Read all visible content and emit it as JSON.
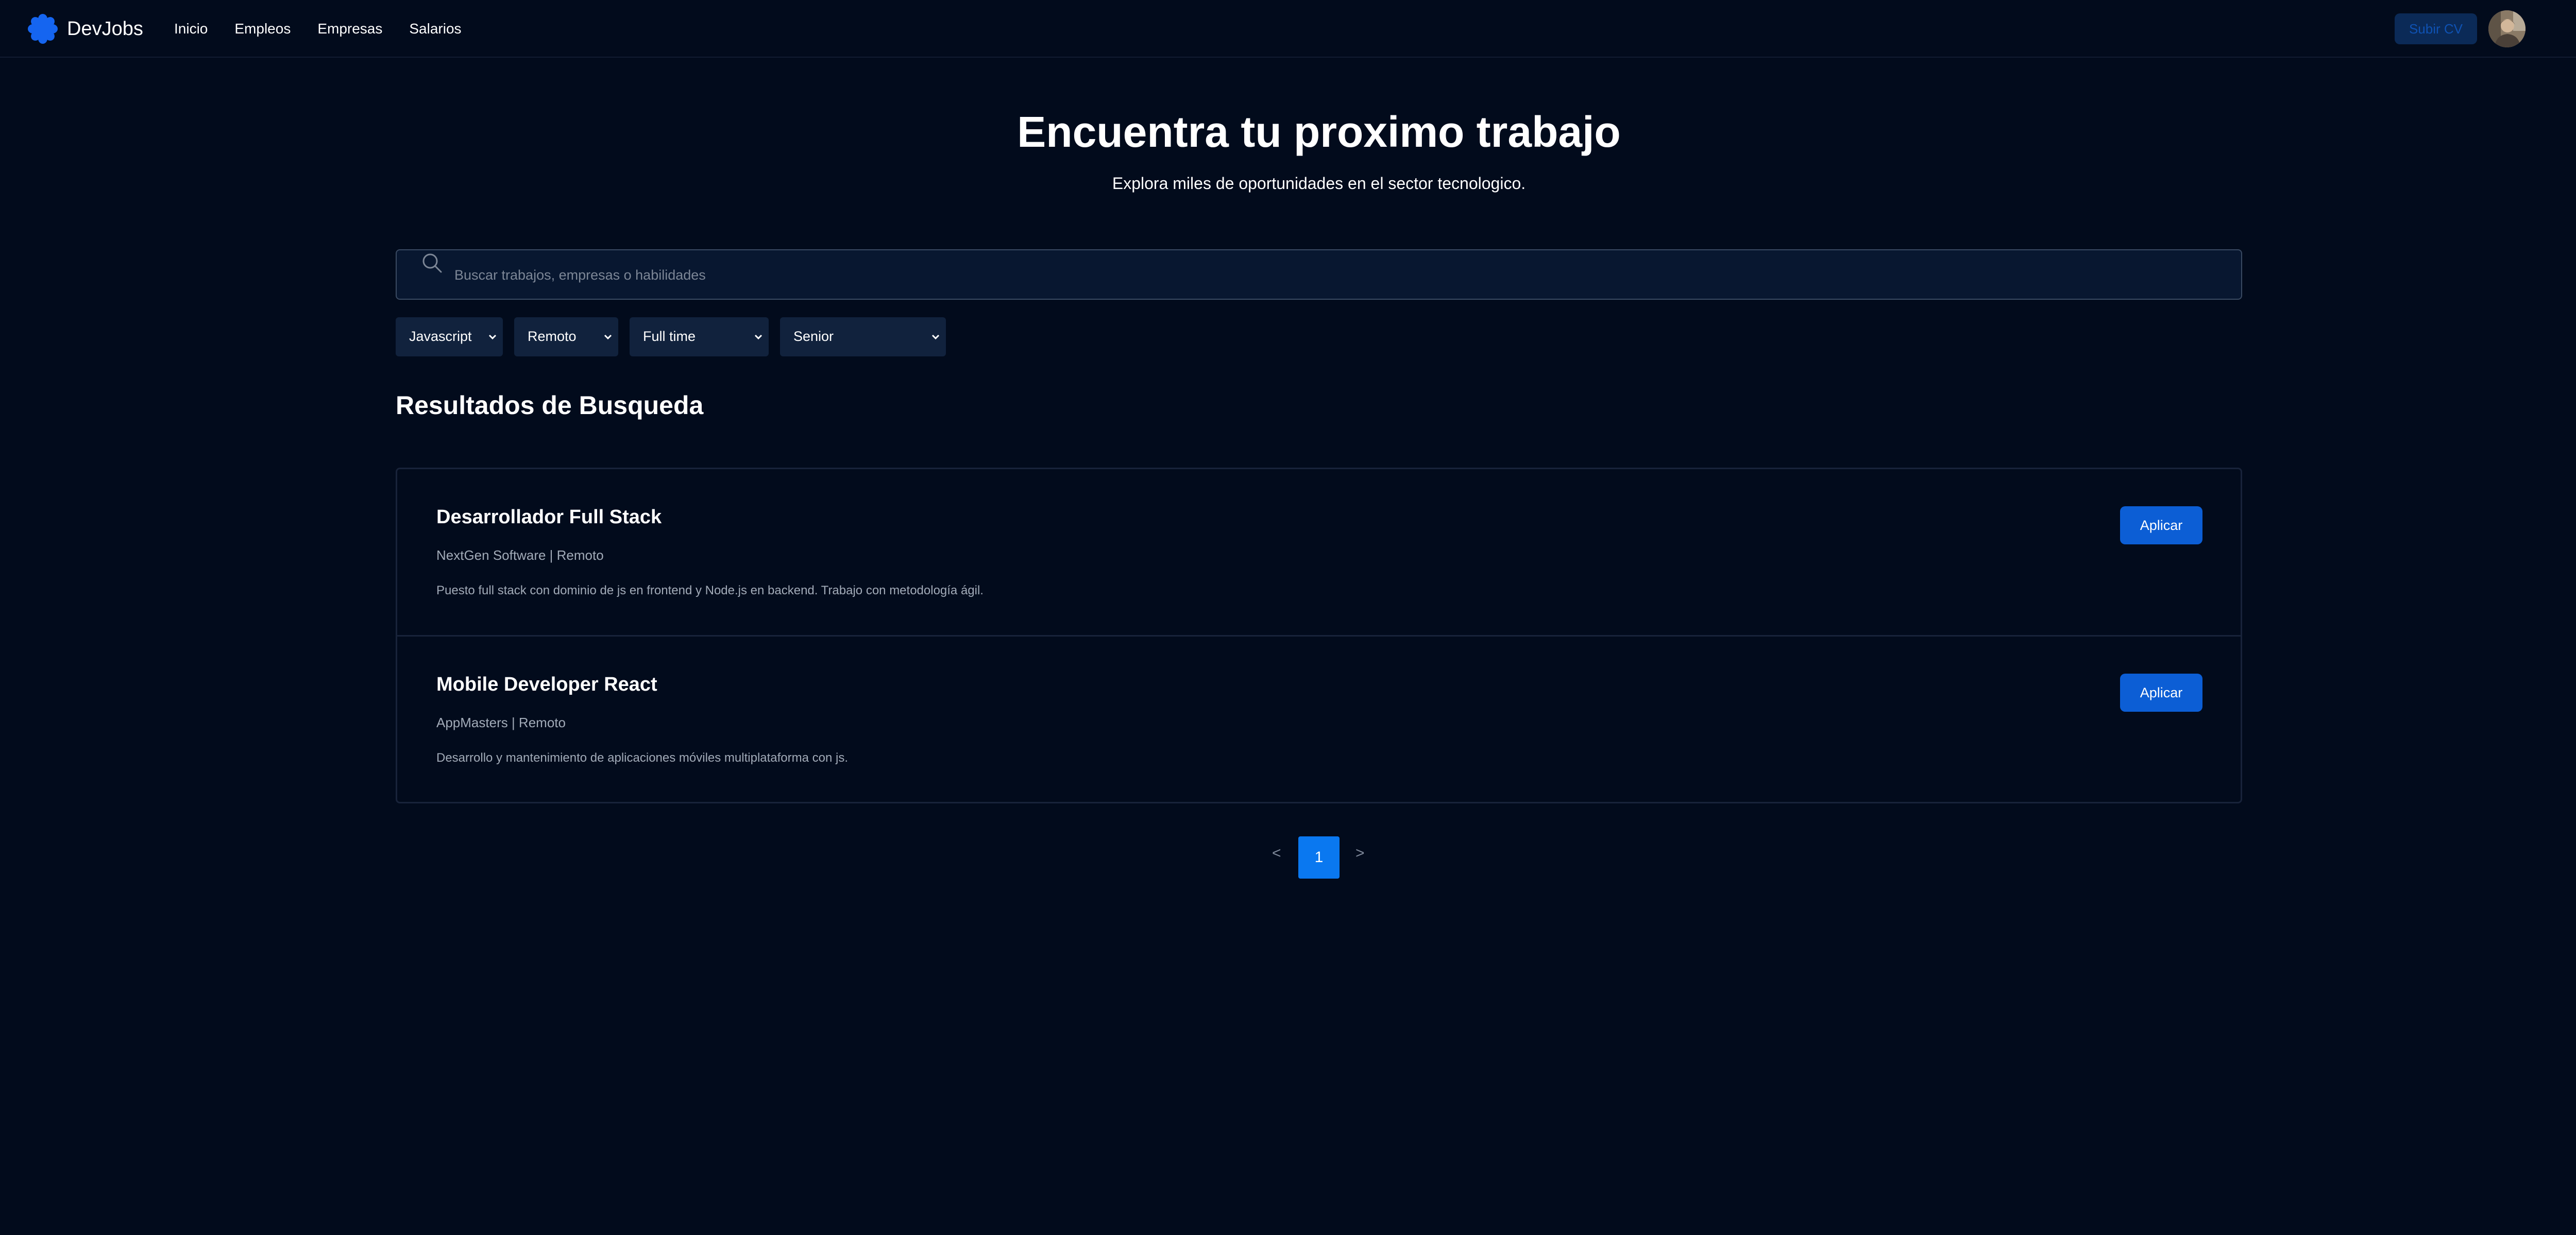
{
  "brand": {
    "name": "DevJobs",
    "logo_icon": "gear-flower-icon",
    "accent": "#1565f0"
  },
  "nav": {
    "items": [
      "Inicio",
      "Empleos",
      "Empresas",
      "Salarios"
    ]
  },
  "header": {
    "upload_cv_label": "Subir CV",
    "avatar_icon": "user-avatar"
  },
  "hero": {
    "title": "Encuentra tu proximo trabajo",
    "subtitle": "Explora miles de oportunidades en el sector tecnologico."
  },
  "search": {
    "placeholder": "Buscar trabajos, empresas o habilidades",
    "value": "",
    "icon": "search-icon"
  },
  "filters": [
    {
      "name": "technology",
      "value": "Javascript"
    },
    {
      "name": "location",
      "value": "Remoto"
    },
    {
      "name": "contract",
      "value": "Full time"
    },
    {
      "name": "level",
      "value": "Senior"
    }
  ],
  "results": {
    "title": "Resultados de Busqueda",
    "jobs": [
      {
        "title": "Desarrollador Full Stack",
        "meta": "NextGen Software | Remoto",
        "description": "Puesto full stack con dominio de js en frontend y Node.js en backend. Trabajo con metodología ágil.",
        "apply_label": "Aplicar"
      },
      {
        "title": "Mobile Developer React",
        "meta": "AppMasters | Remoto",
        "description": "Desarrollo y mantenimiento de aplicaciones móviles multiplataforma con js.",
        "apply_label": "Aplicar"
      }
    ]
  },
  "pagination": {
    "prev": "<",
    "current": "1",
    "next": ">"
  },
  "colors": {
    "background": "#020b1c",
    "primary_button": "#0c5ed5",
    "active_page": "#0a78f0"
  }
}
